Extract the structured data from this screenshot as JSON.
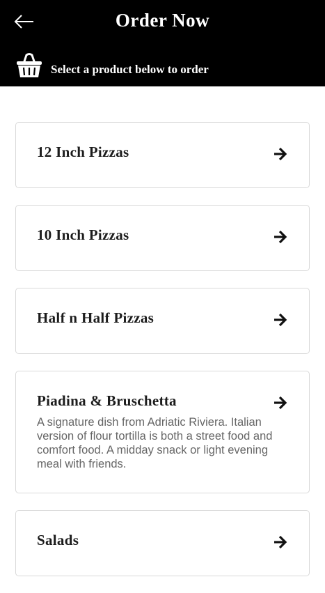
{
  "header": {
    "title": "Order Now",
    "subtitle": "Select a product below to order",
    "back_icon": "arrow-left-icon",
    "basket_icon": "basket-icon",
    "background": "#000000"
  },
  "products": [
    {
      "title": "12 Inch Pizzas",
      "description": ""
    },
    {
      "title": "10 Inch Pizzas",
      "description": ""
    },
    {
      "title": "Half n Half Pizzas",
      "description": ""
    },
    {
      "title": "Piadina & Bruschetta",
      "description": "A signature dish from Adriatic Riviera. Italian version of flour tortilla is both a street food and comfort food. A midday snack or light evening meal with friends."
    },
    {
      "title": "Salads",
      "description": ""
    }
  ]
}
